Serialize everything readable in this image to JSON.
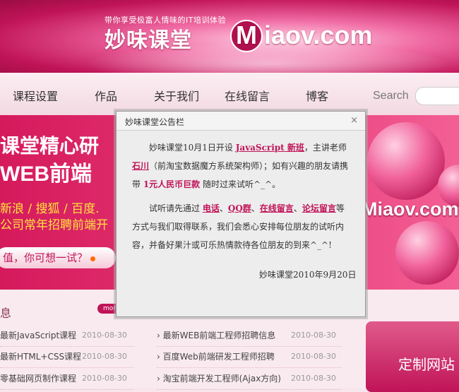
{
  "header": {
    "tagline": "带你享受极富人情味的IT培训体验",
    "brand_cn": "妙味课堂",
    "brand_en_m": "M",
    "brand_en_rest": "iaov.com"
  },
  "nav": {
    "items": [
      "课程设置",
      "作品",
      "关于我们",
      "在线留言",
      "博客"
    ],
    "search_label": "Search"
  },
  "banner": {
    "line1": "课堂精心研",
    "line2": "WEB前端",
    "line3": "新浪 / 搜狐 / 百度.",
    "line4": "公司常年招聘前端开",
    "cta": "值，你可想一试？",
    "logo": "Miaov.com"
  },
  "lower": {
    "section_title": "息",
    "more": "more",
    "left_news": [
      {
        "title": "最新JavaScript课程",
        "date": "2010-08-30"
      },
      {
        "title": "最新HTML+CSS课程",
        "date": "2010-08-30"
      },
      {
        "title": "零基础网页制作课程",
        "date": "2010-08-30"
      }
    ],
    "right_news": [
      {
        "title": "最新WEB前端工程师招聘信息",
        "date": "2010-08-30"
      },
      {
        "title": "百度Web前端研发工程师招聘",
        "date": "2010-08-30"
      },
      {
        "title": "淘宝前端开发工程师(Ajax方向)",
        "date": "2010-08-30"
      }
    ],
    "custom_box": "定制网站"
  },
  "dialog": {
    "title": "妙味课堂公告栏",
    "close": "×",
    "p1_a": "妙味课堂10月1日开设 ",
    "p1_course": "JavaScript 新班",
    "p1_b": "，主讲老师",
    "p1_teacher": "石川",
    "p1_c": "（前淘宝数据魔方系统架构师）；如有兴趣的朋友请携带 ",
    "p1_money": "1元人民币巨款",
    "p1_d": " 随时过来试听^_^。",
    "p2_a": "试听请先通过 ",
    "p2_c1": "电话",
    "p2_sep1": "、",
    "p2_c2": "QQ群",
    "p2_sep2": "、",
    "p2_c3": "在线留言",
    "p2_sep3": "、",
    "p2_c4": "论坛留言",
    "p2_b": "等方式与我们取得联系，我们会悉心安排每位朋友的试听内容，并备好果汁或可乐热情款待各位朋友的到来^_^!",
    "signature": "妙味课堂2010年9月20日"
  },
  "colors": {
    "accent": "#c01458",
    "banner": "#e73a77"
  }
}
